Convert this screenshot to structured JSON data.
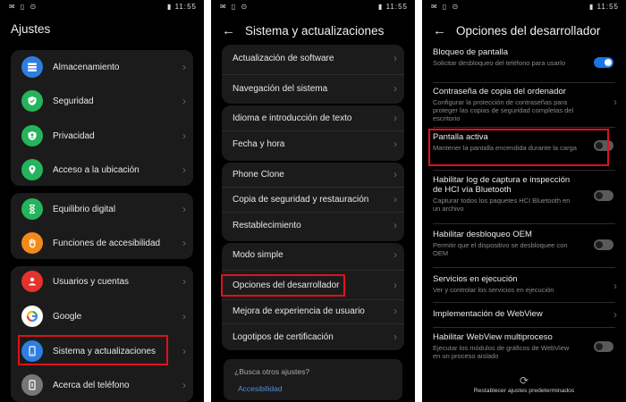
{
  "status": {
    "left": "✉ ▯ ⊙",
    "time": "11:55"
  },
  "screens": {
    "ajustes": {
      "title": "Ajustes",
      "items": [
        {
          "label": "Almacenamiento",
          "icon": "storage-icon",
          "color": "#2e7de0"
        },
        {
          "label": "Seguridad",
          "icon": "security-shield-icon",
          "color": "#25b35c"
        },
        {
          "label": "Privacidad",
          "icon": "privacy-icon",
          "color": "#25b35c"
        },
        {
          "label": "Acceso a la ubicación",
          "icon": "location-icon",
          "color": "#25b35c"
        },
        {
          "label": "Equilibrio digital",
          "icon": "hourglass-icon",
          "color": "#25b35c"
        },
        {
          "label": "Funciones de accesibilidad",
          "icon": "hand-icon",
          "color": "#f28a1a"
        },
        {
          "label": "Usuarios y cuentas",
          "icon": "user-icon",
          "color": "#e5322d"
        },
        {
          "label": "Google",
          "icon": "google-icon",
          "color": "#ffffff"
        },
        {
          "label": "Sistema y actualizaciones",
          "icon": "phone-system-icon",
          "color": "#2e7de0"
        },
        {
          "label": "Acerca del teléfono",
          "icon": "phone-info-icon",
          "color": "#777777"
        }
      ]
    },
    "sistema": {
      "title": "Sistema y actualizaciones",
      "items": [
        {
          "label": "Actualización de software"
        },
        {
          "label": "Navegación del sistema"
        },
        {
          "label": "Idioma e introducción de texto"
        },
        {
          "label": "Fecha y hora"
        },
        {
          "label": "Phone Clone"
        },
        {
          "label": "Copia de seguridad y restauración"
        },
        {
          "label": "Restablecimiento"
        },
        {
          "label": "Modo simple"
        },
        {
          "label": "Opciones del desarrollador"
        },
        {
          "label": "Mejora de experiencia de usuario"
        },
        {
          "label": "Logotipos de certificación"
        }
      ],
      "search": {
        "question": "¿Busca otros ajustes?",
        "link": "Accesibilidad"
      }
    },
    "desarrollador": {
      "title": "Opciones del desarrollador",
      "items": [
        {
          "title": "Bloqueo de pantalla",
          "subtitle": "Solicitar desbloqueo del teléfono para usarlo",
          "control": "toggle-on"
        },
        {
          "title": "Contraseña de copia del ordenador",
          "subtitle": "Configurar la protección de contraseñas para proteger las copias de seguridad completas del escritorio",
          "control": "chevron"
        },
        {
          "title": "Pantalla activa",
          "subtitle": "Mantener la pantalla encendida durante la carga",
          "control": "toggle-off"
        },
        {
          "title": "Habilitar log de captura e inspección de HCI vía Bluetooth",
          "subtitle": "Capturar todos los paquetes HCI Bluetooth en un archivo",
          "control": "toggle-off"
        },
        {
          "title": "Habilitar desbloqueo OEM",
          "subtitle": "Permitir que el dispositivo se desbloquee con OEM",
          "control": "toggle-off"
        },
        {
          "title": "Servicios en ejecución",
          "subtitle": "Ver y controlar los servicios en ejecución",
          "control": "chevron"
        },
        {
          "title": "Implementación de WebView",
          "subtitle": "",
          "control": "chevron"
        },
        {
          "title": "Habilitar WebView multiproceso",
          "subtitle": "Ejecutar los módulos de gráficos de WebView en un proceso aislado",
          "control": "toggle-off"
        }
      ],
      "restore_label": "Restablecer ajustes predeterminados"
    }
  }
}
